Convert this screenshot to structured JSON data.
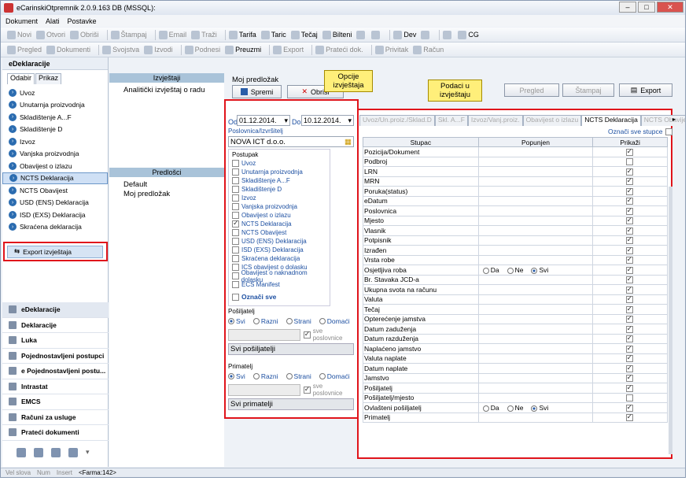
{
  "window": {
    "title": "eCarinskiOtpremnik 2.0.9.163 DB (MSSQL):"
  },
  "menu": [
    "Dokument",
    "Alati",
    "Postavke"
  ],
  "toolbar1": [
    {
      "label": "Novi",
      "on": false
    },
    {
      "label": "Otvori",
      "on": false
    },
    {
      "label": "Obriši",
      "on": false
    },
    {
      "label": "Štampaj",
      "on": false
    },
    {
      "label": "Email",
      "on": false
    },
    {
      "label": "Traži",
      "on": false
    },
    {
      "label": "Tarifa",
      "on": true
    },
    {
      "label": "Taric",
      "on": true
    },
    {
      "label": "Tečaj",
      "on": true
    },
    {
      "label": "Bilteni",
      "on": true
    },
    {
      "label": "",
      "on": true
    },
    {
      "label": "",
      "on": true
    },
    {
      "label": "Dev",
      "on": true
    },
    {
      "label": "",
      "on": true
    },
    {
      "label": "",
      "on": true
    },
    {
      "label": "CG",
      "on": true
    }
  ],
  "toolbar2": [
    {
      "label": "Pregled",
      "on": false
    },
    {
      "label": "Dokumenti",
      "on": false
    },
    {
      "label": "Svojstva",
      "on": false
    },
    {
      "label": "Izvodi",
      "on": false
    },
    {
      "label": "Podnesi",
      "on": false
    },
    {
      "label": "Preuzmi",
      "on": true
    },
    {
      "label": "Export",
      "on": false
    },
    {
      "label": "Prateći dok.",
      "on": false
    },
    {
      "label": "Privitak",
      "on": false
    },
    {
      "label": "Račun",
      "on": false
    }
  ],
  "left": {
    "header": "eDeklaracije",
    "tabs": [
      "Odabir",
      "Prikaz"
    ],
    "items": [
      "Uvoz",
      "Unutarnja proizvodnja",
      "Skladištenje A...F",
      "Skladištenje D",
      "Izvoz",
      "Vanjska proizvodnja",
      "Obavijest o izlazu",
      "NCTS Deklaracija",
      "NCTS Obavijest",
      "USD (ENS) Deklaracija",
      "ISD (EXS) Deklaracija",
      "Skraćena deklaracija"
    ],
    "selected_index": 7,
    "export_item": "Export izvještaja"
  },
  "nav": [
    "eDeklaracije",
    "Deklaracije",
    "Luka",
    "Pojednostavljeni postupci",
    "e Pojednostavljeni postu...",
    "Intrastat",
    "EMCS",
    "Računi za usluge",
    "Prateći dokumenti"
  ],
  "status": {
    "velslova": "Vel slova",
    "num": "Num",
    "insert": "Insert",
    "farm": "<Farma:142>"
  },
  "izvjestaji": {
    "header": "Izvještaji",
    "items": [
      "Analitički izvještaj o radu"
    ]
  },
  "predlosci": {
    "header": "Predlošci",
    "items": [
      "Default",
      "Moj predložak"
    ]
  },
  "mp": {
    "title": "Moj predložak",
    "spremi": "Spremi",
    "obrisi": "Obriši"
  },
  "callouts": {
    "opcije": "Opcije izvještaja",
    "podaci": "Podaci u izvještaju"
  },
  "top_buttons": {
    "pregled": "Pregled",
    "stampaj": "Štampaj",
    "export": "Export"
  },
  "opt": {
    "od_label": "Od",
    "od": "01.12.2014.",
    "do_label": "Do",
    "do": "10.12.2014.",
    "posl_label": "Poslovnica/Izvršitelj",
    "posl": "NOVA ICT d.o.o.",
    "postupak_label": "Postupak",
    "postupci": [
      {
        "l": "Uvoz",
        "c": false
      },
      {
        "l": "Unutarnja proizvodnja",
        "c": false
      },
      {
        "l": "Skladištenje A...F",
        "c": false
      },
      {
        "l": "Skladištenje D",
        "c": false
      },
      {
        "l": "Izvoz",
        "c": false
      },
      {
        "l": "Vanjska proizvodnja",
        "c": false
      },
      {
        "l": "Obavijest o izlazu",
        "c": false
      },
      {
        "l": "NCTS Deklaracija",
        "c": true
      },
      {
        "l": "NCTS Obavijest",
        "c": false
      },
      {
        "l": "USD (ENS) Deklaracija",
        "c": false
      },
      {
        "l": "ISD (EXS) Deklaracija",
        "c": false
      },
      {
        "l": "Skraćena deklaracija",
        "c": false
      },
      {
        "l": "ICS obavijest o dolasku",
        "c": false
      },
      {
        "l": "Obavijest o naknadnom dolasku",
        "c": false
      },
      {
        "l": "ECS Manifest",
        "c": false
      }
    ],
    "oznaci_sve": "Označi sve",
    "posiljatelj": {
      "label": "Pošiljatelj",
      "radios": [
        "Svi",
        "Razni",
        "Strani",
        "Domaći"
      ],
      "sve": "sve poslovnice",
      "btn": "Svi pošiljatelji"
    },
    "primatelj": {
      "label": "Primatelj",
      "radios": [
        "Svi",
        "Razni",
        "Strani",
        "Domaći"
      ],
      "sve": "sve poslovnice",
      "btn": "Svi primatelji"
    }
  },
  "tabs": [
    {
      "l": "Uvoz/Un.proiz./Sklad.D",
      "s": false
    },
    {
      "l": "Skl. A...F",
      "s": false
    },
    {
      "l": "Izvoz/Vanj.proiz.",
      "s": false
    },
    {
      "l": "Obavijest o izlazu",
      "s": false
    },
    {
      "l": "NCTS Deklaracija",
      "s": true
    },
    {
      "l": "NCTS Obavijest",
      "s": false
    }
  ],
  "oznaci_sve_stupce": "Označi sve stupce",
  "grid": {
    "headers": [
      "Stupac",
      "Popunjen",
      "Prikaži"
    ],
    "radio_labels": [
      "Da",
      "Ne",
      "Svi"
    ],
    "rows": [
      {
        "n": "Pozicija/Dokument",
        "c": true,
        "r": false
      },
      {
        "n": "Podbroj",
        "c": false,
        "r": false
      },
      {
        "n": "LRN",
        "c": true,
        "r": false
      },
      {
        "n": "MRN",
        "c": true,
        "r": false
      },
      {
        "n": "Poruka(status)",
        "c": true,
        "r": false
      },
      {
        "n": "eDatum",
        "c": true,
        "r": false
      },
      {
        "n": "Poslovnica",
        "c": true,
        "r": false
      },
      {
        "n": "Mjesto",
        "c": true,
        "r": false
      },
      {
        "n": "Vlasnik",
        "c": true,
        "r": false
      },
      {
        "n": "Potpisnik",
        "c": true,
        "r": false
      },
      {
        "n": "Izrađen",
        "c": true,
        "r": false
      },
      {
        "n": "Vrsta robe",
        "c": true,
        "r": false
      },
      {
        "n": "Osjetljiva roba",
        "c": true,
        "r": true
      },
      {
        "n": "Br. Stavaka JCD-a",
        "c": true,
        "r": false
      },
      {
        "n": "Ukupna svota na računu",
        "c": true,
        "r": false
      },
      {
        "n": "Valuta",
        "c": true,
        "r": false
      },
      {
        "n": "Tečaj",
        "c": true,
        "r": false
      },
      {
        "n": "Opterećenje jamstva",
        "c": true,
        "r": false
      },
      {
        "n": "Datum zaduženja",
        "c": true,
        "r": false
      },
      {
        "n": "Datum razduženja",
        "c": true,
        "r": false
      },
      {
        "n": "Naplaćeno jamstvo",
        "c": true,
        "r": false
      },
      {
        "n": "Valuta naplate",
        "c": true,
        "r": false
      },
      {
        "n": "Datum naplate",
        "c": true,
        "r": false
      },
      {
        "n": "Jamstvo",
        "c": true,
        "r": false
      },
      {
        "n": "Pošiljatelj",
        "c": true,
        "r": false
      },
      {
        "n": "Pošiljatelj/mjesto",
        "c": false,
        "r": false
      },
      {
        "n": "Ovlašteni pošiljatelj",
        "c": true,
        "r": true
      },
      {
        "n": "Primatelj",
        "c": true,
        "r": false
      }
    ]
  }
}
